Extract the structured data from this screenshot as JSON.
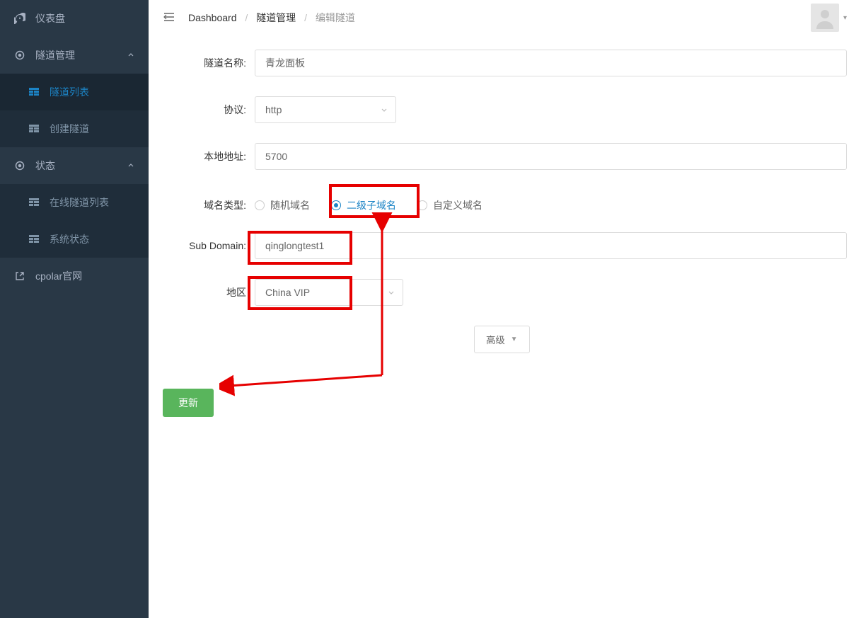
{
  "sidebar": {
    "items": [
      {
        "label": "仪表盘"
      },
      {
        "label": "隧道管理"
      },
      {
        "label": "隧道列表"
      },
      {
        "label": "创建隧道"
      },
      {
        "label": "状态"
      },
      {
        "label": "在线隧道列表"
      },
      {
        "label": "系统状态"
      },
      {
        "label": "cpolar官网"
      }
    ]
  },
  "breadcrumb": {
    "root": "Dashboard",
    "section": "隧道管理",
    "current": "编辑隧道"
  },
  "form": {
    "name_label": "隧道名称:",
    "name_value": "青龙面板",
    "protocol_label": "协议:",
    "protocol_value": "http",
    "local_addr_label": "本地地址:",
    "local_addr_value": "5700",
    "domain_type_label": "域名类型:",
    "domain_type_options": {
      "random": "随机域名",
      "sub": "二级子域名",
      "custom": "自定义域名"
    },
    "subdomain_label": "Sub Domain:",
    "subdomain_value": "qinglongtest1",
    "region_label": "地区",
    "region_value": "China VIP",
    "advanced_label": "高级",
    "submit_label": "更新"
  }
}
